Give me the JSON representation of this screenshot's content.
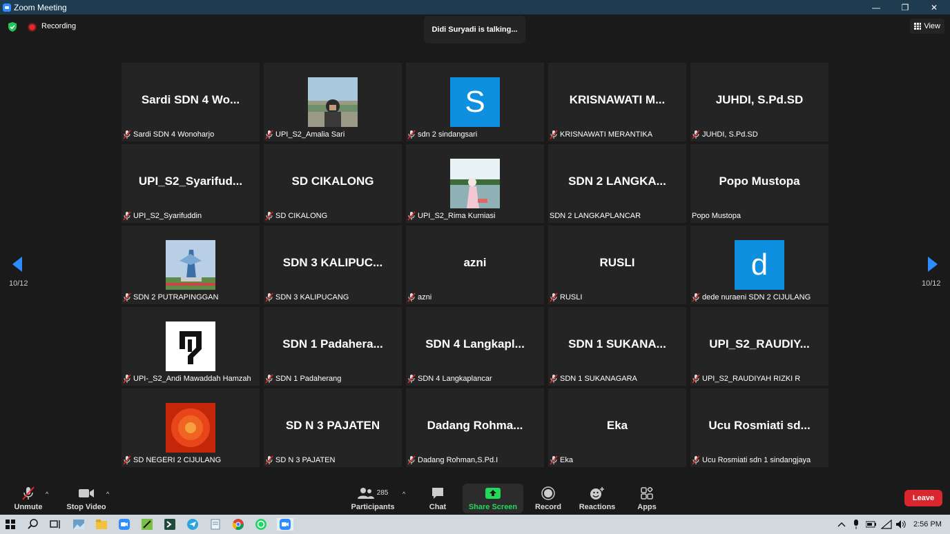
{
  "window": {
    "title": "Zoom Meeting"
  },
  "status": {
    "recording_label": "Recording",
    "talking": "Didi Suryadi is talking...",
    "view_label": "View"
  },
  "pagination": {
    "left": "10/12",
    "right": "10/12"
  },
  "tiles": [
    {
      "big": "Sardi SDN 4 Wo...",
      "label": "Sardi SDN 4 Wonoharjo",
      "muted": true,
      "pic": ""
    },
    {
      "big": "",
      "label": "UPI_S2_Amalia Sari",
      "muted": true,
      "pic": "photo-beach"
    },
    {
      "big": "",
      "label": "sdn 2 sindangsari",
      "muted": true,
      "pic": "letter",
      "letter": "S"
    },
    {
      "big": "KRISNAWATI  M...",
      "label": "KRISNAWATI MERANTIKA",
      "muted": true,
      "pic": ""
    },
    {
      "big": "JUHDI, S.Pd.SD",
      "label": "JUHDI, S.Pd.SD",
      "muted": true,
      "pic": ""
    },
    {
      "big": "UPI_S2_Syarifud...",
      "label": "UPI_S2_Syarifuddin",
      "muted": true,
      "pic": ""
    },
    {
      "big": "SD CIKALONG",
      "label": "SD CIKALONG",
      "muted": true,
      "pic": ""
    },
    {
      "big": "",
      "label": "UPI_S2_Rima Kurniasi",
      "muted": true,
      "pic": "photo-lake"
    },
    {
      "big": "SDN 2 LANGKA...",
      "label": "SDN 2 LANGKAPLANCAR",
      "muted": false,
      "pic": ""
    },
    {
      "big": "Popo Mustopa",
      "label": "Popo Mustopa",
      "muted": false,
      "pic": ""
    },
    {
      "big": "",
      "label": "SDN 2 PUTRAPINGGAN",
      "muted": true,
      "pic": "photo-monument"
    },
    {
      "big": "SDN 3 KALIPUC...",
      "label": "SDN 3 KALIPUCANG",
      "muted": true,
      "pic": ""
    },
    {
      "big": "azni",
      "label": "azni",
      "muted": true,
      "pic": ""
    },
    {
      "big": "RUSLI",
      "label": "RUSLI",
      "muted": true,
      "pic": ""
    },
    {
      "big": "",
      "label": "dede nuraeni SDN 2 CIJULANG",
      "muted": true,
      "pic": "letter",
      "letter": "d"
    },
    {
      "big": "",
      "label": "UPI-_S2_Andi Mawaddah Hamzah",
      "muted": true,
      "pic": "logo"
    },
    {
      "big": "SDN 1 Padahera...",
      "label": "SDN 1 Padaherang",
      "muted": true,
      "pic": ""
    },
    {
      "big": "SDN 4 Langkapl...",
      "label": "SDN 4 Langkaplancar",
      "muted": true,
      "pic": ""
    },
    {
      "big": "SDN 1 SUKANA...",
      "label": "SDN 1 SUKANAGARA",
      "muted": true,
      "pic": ""
    },
    {
      "big": "UPI_S2_RAUDIY...",
      "label": "UPI_S2_RAUDIYAH RIZKI R",
      "muted": true,
      "pic": ""
    },
    {
      "big": "",
      "label": "SD NEGERI 2 CIJULANG",
      "muted": true,
      "pic": "photo-flower"
    },
    {
      "big": "SD N 3 PAJATEN",
      "label": "SD N 3 PAJATEN",
      "muted": true,
      "pic": ""
    },
    {
      "big": "Dadang  Rohma...",
      "label": "Dadang Rohman,S.Pd.I",
      "muted": true,
      "pic": ""
    },
    {
      "big": "Eka",
      "label": "Eka",
      "muted": true,
      "pic": ""
    },
    {
      "big": "Ucu  Rosmiati  sd...",
      "label": "Ucu Rosmiati sdn 1 sindangjaya",
      "muted": true,
      "pic": ""
    }
  ],
  "toolbar": {
    "unmute": "Unmute",
    "stop_video": "Stop Video",
    "participants": "Participants",
    "participant_count": "285",
    "chat": "Chat",
    "share_screen": "Share Screen",
    "record": "Record",
    "reactions": "Reactions",
    "apps": "Apps",
    "leave": "Leave"
  },
  "taskbar": {
    "time": "2:56 PM"
  },
  "colors": {
    "accent": "#2d8cff",
    "share_green": "#23d959",
    "leave_red": "#d9262f",
    "tile_bg": "#242424"
  }
}
